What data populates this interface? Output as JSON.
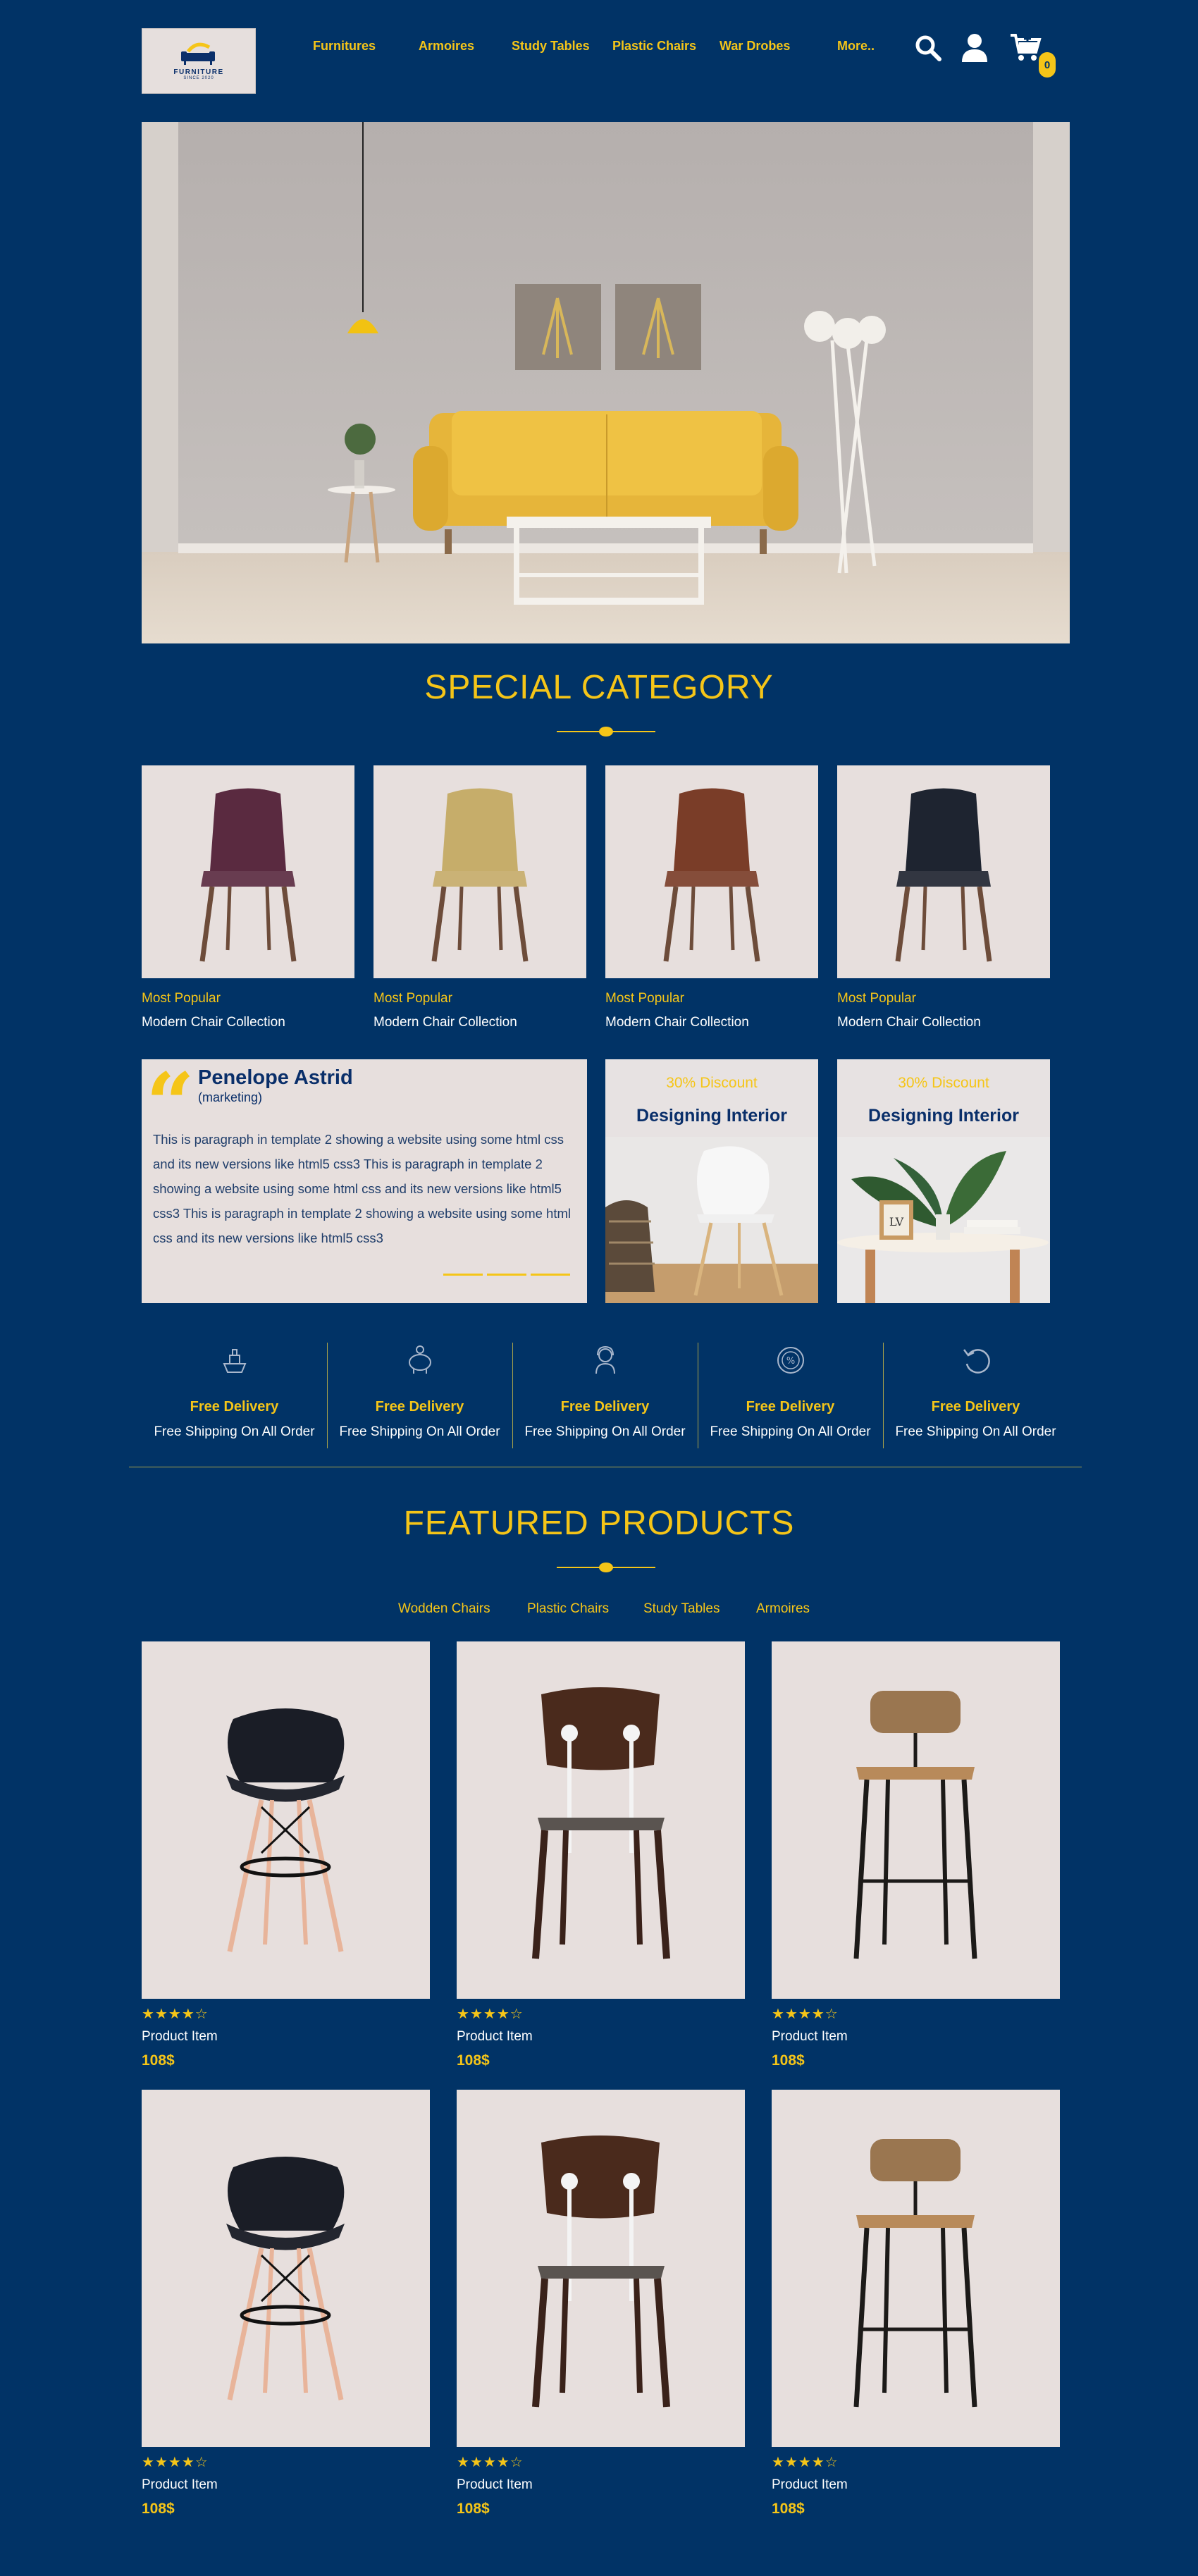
{
  "header": {
    "logo_text": "FURNITURE",
    "logo_sub": "SINCE 2020",
    "nav": [
      "Furnitures",
      "Armoires",
      "Study Tables",
      "Plastic Chairs",
      "War Drobes",
      "More.."
    ],
    "cart_count": "0"
  },
  "special_category": {
    "title": "SPECIAL CATEGORY",
    "cards": [
      {
        "tag": "Most Popular",
        "name": "Modern Chair Collection",
        "chair_color": "#5a2a40"
      },
      {
        "tag": "Most Popular",
        "name": "Modern Chair Collection",
        "chair_color": "#c6ad6a"
      },
      {
        "tag": "Most Popular",
        "name": "Modern Chair Collection",
        "chair_color": "#7a3d28"
      },
      {
        "tag": "Most Popular",
        "name": "Modern Chair Collection",
        "chair_color": "#1e2430"
      }
    ]
  },
  "testimonial": {
    "name": "Penelope Astrid",
    "role": "(marketing)",
    "body": "This is paragraph in template 2 showing a website using some html css and its new versions like html5 css3 This is paragraph in template 2 showing a website using some html css and its new versions like html5 css3 This is paragraph in template 2 showing a website using some html css and its new versions like html5 css3"
  },
  "discounts": [
    {
      "percent": "30% Discount",
      "title": "Designing Interior"
    },
    {
      "percent": "30% Discount",
      "title": "Designing Interior"
    }
  ],
  "features": [
    {
      "title": "Free Delivery",
      "subtitle": "Free Shipping On All Order",
      "icon": "ship-icon"
    },
    {
      "title": "Free Delivery",
      "subtitle": "Free Shipping On All Order",
      "icon": "piggy-bank-icon"
    },
    {
      "title": "Free Delivery",
      "subtitle": "Free Shipping On All Order",
      "icon": "support-agent-icon"
    },
    {
      "title": "Free Delivery",
      "subtitle": "Free Shipping On All Order",
      "icon": "percent-badge-icon"
    },
    {
      "title": "Free Delivery",
      "subtitle": "Free Shipping On All Order",
      "icon": "return-arrow-icon"
    }
  ],
  "featured_products": {
    "title": "FEATURED PRODUCTS",
    "tabs": [
      "Wodden Chairs",
      "Plastic Chairs",
      "Study Tables",
      "Armoires"
    ],
    "products": [
      {
        "name": "Product Item",
        "price": "108$",
        "rating": 4,
        "max_rating": 5,
        "style": "eames"
      },
      {
        "name": "Product Item",
        "price": "108$",
        "rating": 4,
        "max_rating": 5,
        "style": "school"
      },
      {
        "name": "Product Item",
        "price": "108$",
        "rating": 4,
        "max_rating": 5,
        "style": "stool"
      },
      {
        "name": "Product Item",
        "price": "108$",
        "rating": 4,
        "max_rating": 5,
        "style": "eames"
      },
      {
        "name": "Product Item",
        "price": "108$",
        "rating": 4,
        "max_rating": 5,
        "style": "school"
      },
      {
        "name": "Product Item",
        "price": "108$",
        "rating": 4,
        "max_rating": 5,
        "style": "stool"
      }
    ]
  },
  "colors": {
    "background": "#013366",
    "accent": "#f5c518",
    "card": "#e7dfdd"
  }
}
